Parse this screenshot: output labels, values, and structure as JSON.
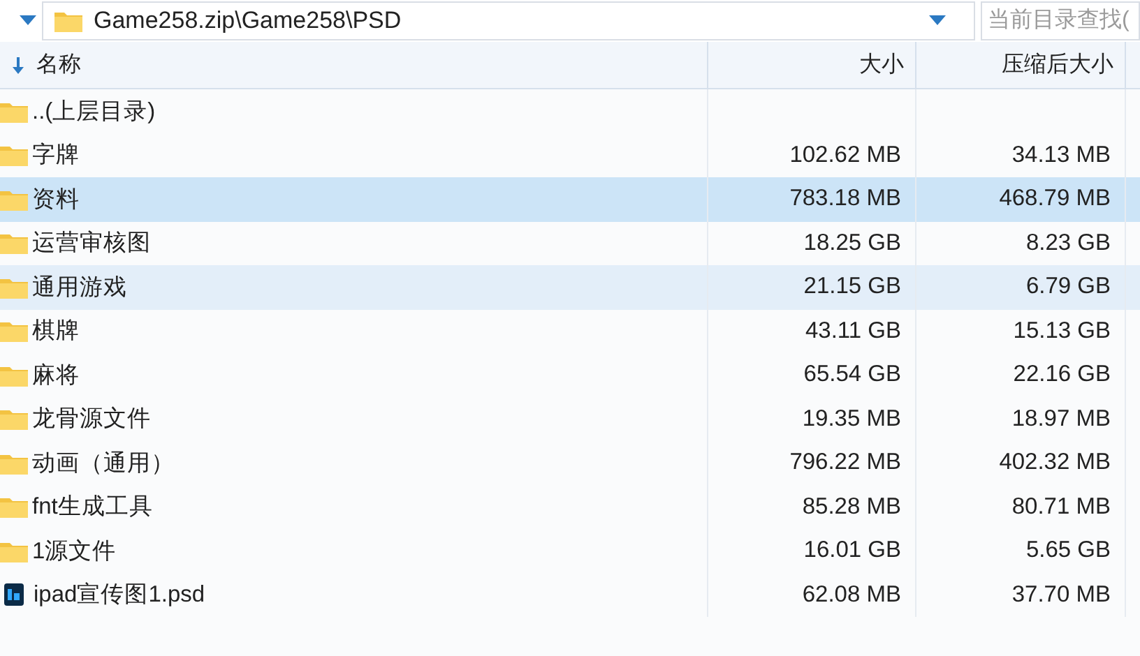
{
  "address_bar": {
    "path": "Game258.zip\\Game258\\PSD"
  },
  "search": {
    "placeholder": "当前目录查找("
  },
  "table": {
    "columns": [
      {
        "label": "名称",
        "sorted": true
      },
      {
        "label": "大小",
        "sorted": false
      },
      {
        "label": "压缩后大小",
        "sorted": false
      }
    ],
    "rows": [
      {
        "kind": "parent",
        "name": "..(上层目录)",
        "size": "",
        "packed": "",
        "selected": false,
        "hovered": false
      },
      {
        "kind": "folder",
        "name": "字牌",
        "size": "102.62 MB",
        "packed": "34.13 MB",
        "selected": false,
        "hovered": false
      },
      {
        "kind": "folder",
        "name": "资料",
        "size": "783.18 MB",
        "packed": "468.79 MB",
        "selected": true,
        "hovered": false
      },
      {
        "kind": "folder",
        "name": "运营审核图",
        "size": "18.25 GB",
        "packed": "8.23 GB",
        "selected": false,
        "hovered": false
      },
      {
        "kind": "folder",
        "name": "通用游戏",
        "size": "21.15 GB",
        "packed": "6.79 GB",
        "selected": false,
        "hovered": true
      },
      {
        "kind": "folder",
        "name": "棋牌",
        "size": "43.11 GB",
        "packed": "15.13 GB",
        "selected": false,
        "hovered": false
      },
      {
        "kind": "folder",
        "name": "麻将",
        "size": "65.54 GB",
        "packed": "22.16 GB",
        "selected": false,
        "hovered": false
      },
      {
        "kind": "folder",
        "name": "龙骨源文件",
        "size": "19.35 MB",
        "packed": "18.97 MB",
        "selected": false,
        "hovered": false
      },
      {
        "kind": "folder",
        "name": "动画（通用）",
        "size": "796.22 MB",
        "packed": "402.32 MB",
        "selected": false,
        "hovered": false
      },
      {
        "kind": "folder",
        "name": "fnt生成工具",
        "size": "85.28 MB",
        "packed": "80.71 MB",
        "selected": false,
        "hovered": false
      },
      {
        "kind": "folder",
        "name": "1源文件",
        "size": "16.01 GB",
        "packed": "5.65 GB",
        "selected": false,
        "hovered": false
      },
      {
        "kind": "psd",
        "name": "ipad宣传图1.psd",
        "size": "62.08 MB",
        "packed": "37.70 MB",
        "selected": false,
        "hovered": false
      }
    ]
  }
}
